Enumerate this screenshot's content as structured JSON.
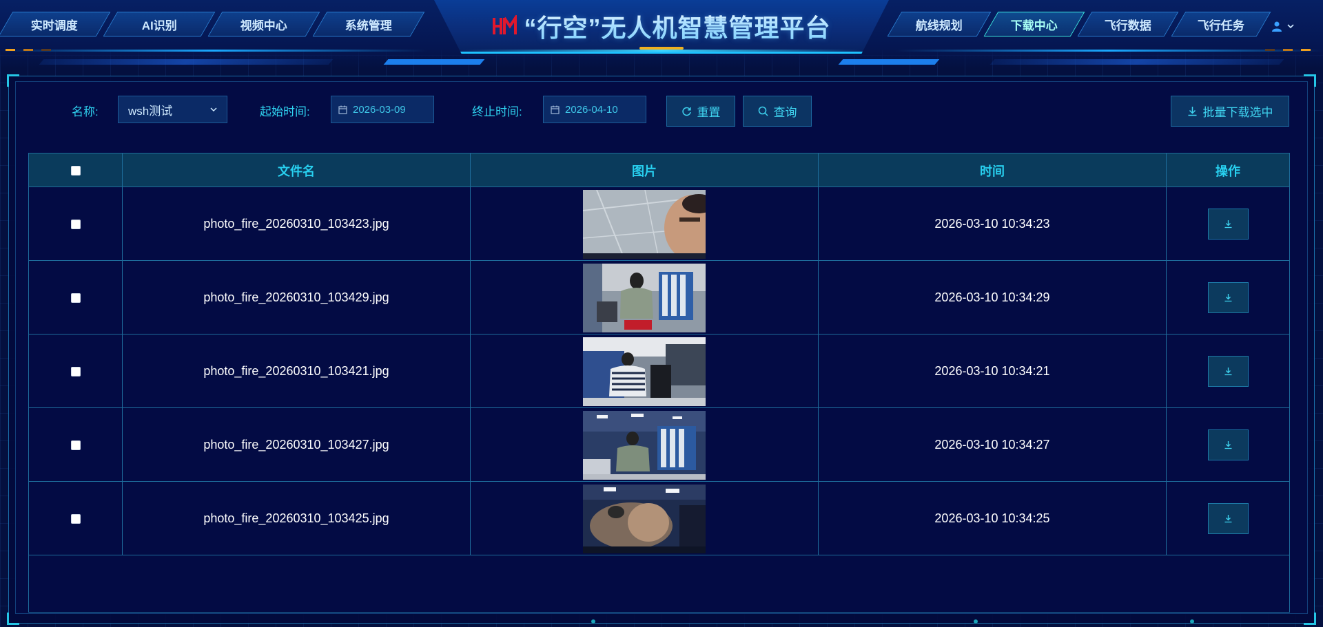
{
  "app": {
    "title": "“行空”无人机智慧管理平台",
    "accent": "#2fd3f0",
    "logo_color": "#e0182d"
  },
  "nav": {
    "left": [
      {
        "label": "实时调度",
        "active": false
      },
      {
        "label": "AI识别",
        "active": false
      },
      {
        "label": "视频中心",
        "active": false
      },
      {
        "label": "系统管理",
        "active": false
      }
    ],
    "right": [
      {
        "label": "航线规划",
        "active": false
      },
      {
        "label": "下载中心",
        "active": true
      },
      {
        "label": "飞行数据",
        "active": false
      },
      {
        "label": "飞行任务",
        "active": false
      }
    ]
  },
  "filters": {
    "name_label": "名称:",
    "name_value": "wsh测试",
    "start_label": "起始时间:",
    "start_value": "2026-03-09",
    "end_label": "终止时间:",
    "end_value": "2026-04-10",
    "reset_label": "重置",
    "query_label": "查询",
    "batch_label": "批量下载选中"
  },
  "table": {
    "headers": [
      "文件名",
      "图片",
      "时间",
      "操作"
    ],
    "rows": [
      {
        "filename": "photo_fire_20260310_103423.jpg",
        "time": "2026-03-10 10:34:23"
      },
      {
        "filename": "photo_fire_20260310_103429.jpg",
        "time": "2026-03-10 10:34:29"
      },
      {
        "filename": "photo_fire_20260310_103421.jpg",
        "time": "2026-03-10 10:34:21"
      },
      {
        "filename": "photo_fire_20260310_103427.jpg",
        "time": "2026-03-10 10:34:27"
      },
      {
        "filename": "photo_fire_20260310_103425.jpg",
        "time": "2026-03-10 10:34:25"
      }
    ]
  }
}
